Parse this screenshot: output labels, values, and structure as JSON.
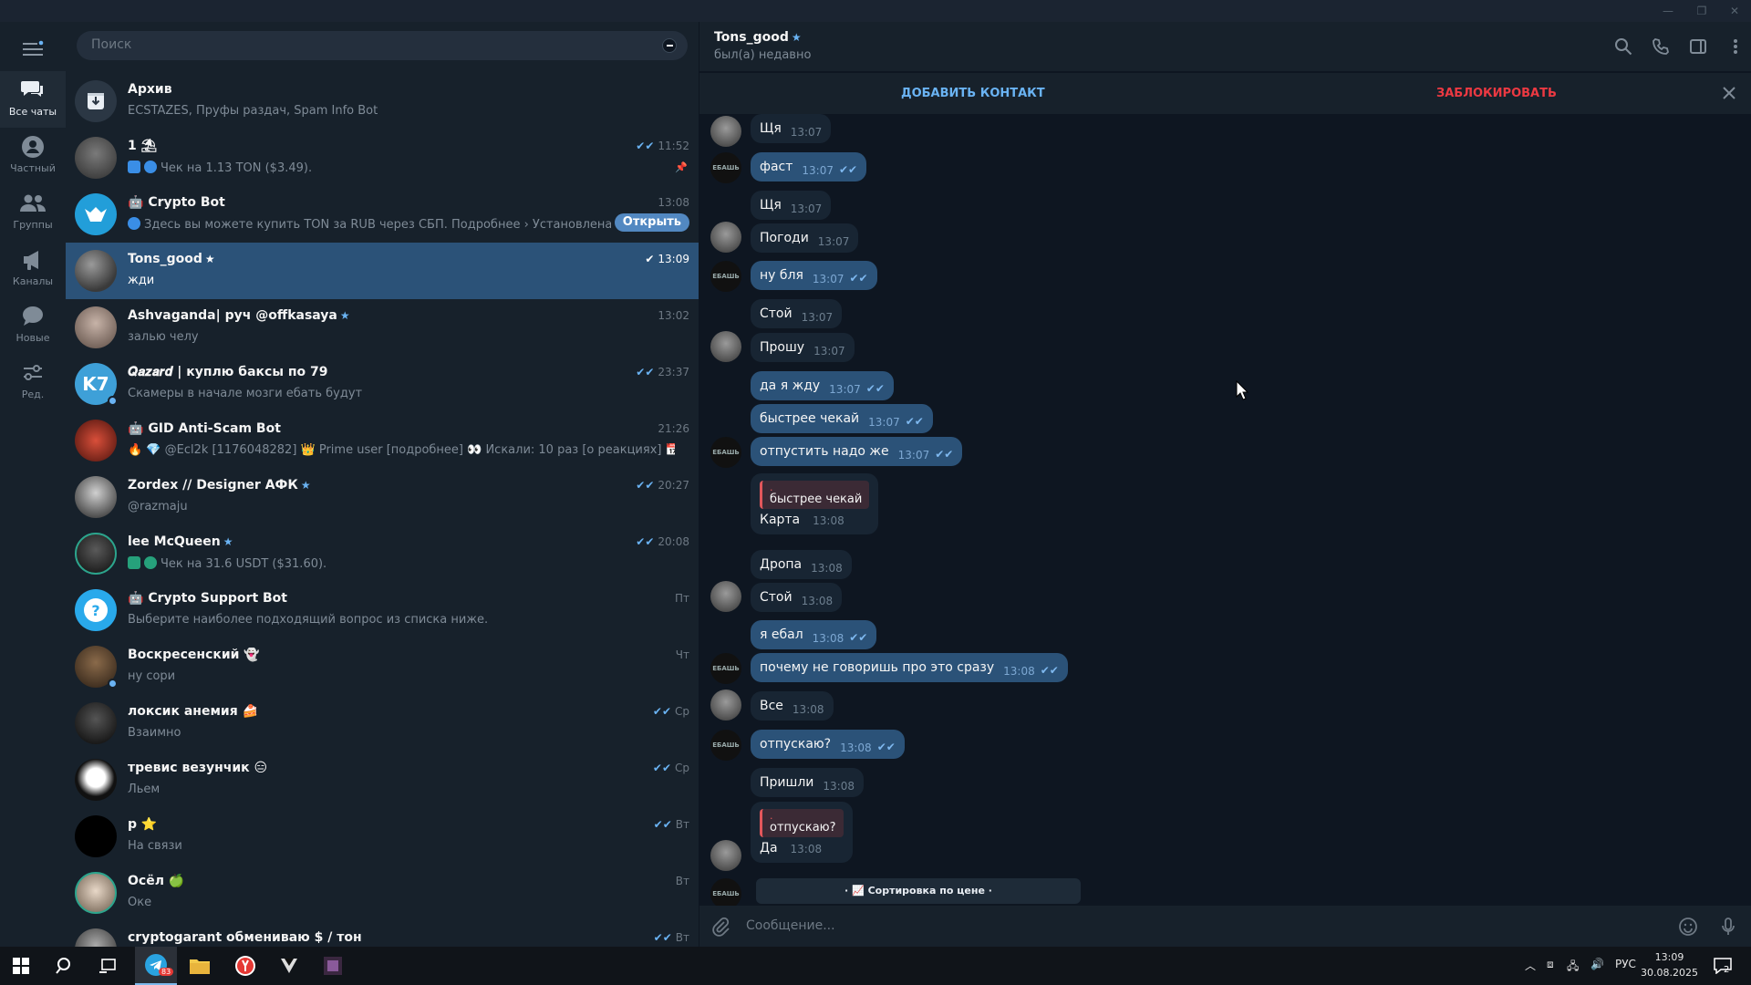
{
  "window": {
    "minimize": "—",
    "maximize": "❐",
    "close": "✕"
  },
  "rail": {
    "items": [
      {
        "label": "Все чаты",
        "icon": "chats-icon"
      },
      {
        "label": "Частный",
        "icon": "user-icon"
      },
      {
        "label": "Группы",
        "icon": "group-icon"
      },
      {
        "label": "Каналы",
        "icon": "megaphone-icon"
      },
      {
        "label": "Новые",
        "icon": "chat-bubble-icon"
      },
      {
        "label": "Ред.",
        "icon": "filter-edit-icon"
      }
    ]
  },
  "search": {
    "placeholder": "Поиск"
  },
  "chats": [
    {
      "name": "Архив",
      "time": "",
      "msg": "ECSTAZES, Пруфы раздач, Spam Info Bot"
    },
    {
      "name": "1 ⛱",
      "time": "11:52",
      "msg": "Чек на  1.13 TON ($3.49)."
    },
    {
      "name": "Crypto Bot",
      "time": "13:08",
      "msg": "Здесь вы можете купить TON за RUB через СБП. Подробнее › Установлена  со...",
      "button": "Открыть"
    },
    {
      "name": "Tons_good",
      "time": "13:09",
      "msg": "жди"
    },
    {
      "name": "Ashvaganda| руч @offkasaya",
      "time": "13:02",
      "msg": "залью челу"
    },
    {
      "name": "𝑸𝒂𝒛𝒂𝒓𝒅 | куплю баксы по 79",
      "time": "23:37",
      "msg": "Скамеры в начале мозги ебать будут",
      "avatar_text": "K7"
    },
    {
      "name": "GID Anti-Scam Bot",
      "time": "21:26",
      "msg": "🔥 💎 @Ecl2k [1176048282] 👑 Prime user [подробнее] 👀 Искали: 10 раз [о реакциях] 📅 Зареги..."
    },
    {
      "name": "Zordex // Designer АФК",
      "time": "20:27",
      "msg": "@razmaju"
    },
    {
      "name": "lee McQueen",
      "time": "20:08",
      "msg": "Чек на  31.6 USDT ($31.60)."
    },
    {
      "name": "Crypto Support Bot",
      "time": "Пт",
      "msg": "Выберите наиболее подходящий вопрос из списка ниже."
    },
    {
      "name": "Воскресенский 👻",
      "time": "Чт",
      "msg": "ну сори"
    },
    {
      "name": "локсик анемия 🍰",
      "time": "Ср",
      "msg": "Взаимно"
    },
    {
      "name": "тревис везунчик 😑",
      "time": "Ср",
      "msg": "Льем"
    },
    {
      "name": "р ⭐",
      "time": "Вт",
      "msg": "На связи"
    },
    {
      "name": "Осёл 🍏",
      "time": "Вт",
      "msg": "Оке"
    },
    {
      "name": "cryptogarant обмениваю $ / тон",
      "time": "Вт",
      "msg": ""
    }
  ],
  "header": {
    "name": "Tons_good",
    "status": "был(а) недавно"
  },
  "actions": {
    "add": "ДОБАВИТЬ КОНТАКТ",
    "block": "ЗАБЛОКИРОВАТЬ"
  },
  "messages": [
    {
      "text": "Щя",
      "time": "13:07"
    },
    {
      "text": "фаст",
      "time": "13:07"
    },
    {
      "text": "Щя",
      "time": "13:07"
    },
    {
      "text": "Погоди",
      "time": "13:07"
    },
    {
      "text": "ну бля",
      "time": "13:07"
    },
    {
      "text": "Стой",
      "time": "13:07"
    },
    {
      "text": "Прошу",
      "time": "13:07"
    },
    {
      "text": "да я жду",
      "time": "13:07"
    },
    {
      "text": "быстрее чекай",
      "time": "13:07"
    },
    {
      "text": "отпустить надо же",
      "time": "13:07"
    },
    {
      "quote": "быстрее чекай",
      "text": "Карта",
      "time": "13:08"
    },
    {
      "text": "Дропа",
      "time": "13:08"
    },
    {
      "text": "Стой",
      "time": "13:08"
    },
    {
      "text": "я ебал",
      "time": "13:08"
    },
    {
      "text": "почему не говоришь про это сразу",
      "time": "13:08"
    },
    {
      "text": "Все",
      "time": "13:08"
    },
    {
      "text": "отпускаю?",
      "time": "13:08"
    },
    {
      "text": "Пришли",
      "time": "13:08"
    },
    {
      "quote": "отпускаю?",
      "text": "Да",
      "time": "13:08"
    }
  ],
  "sort_bar": "· 📈 Сортировка по цене ·",
  "avatar_logo_text": "ЕБАШЬ",
  "composer": {
    "placeholder": "Сообщение..."
  },
  "taskbar": {
    "lang": "РУС",
    "time": "13:09",
    "date": "30.08.2025",
    "notif": "2",
    "tg_badge": "83"
  }
}
